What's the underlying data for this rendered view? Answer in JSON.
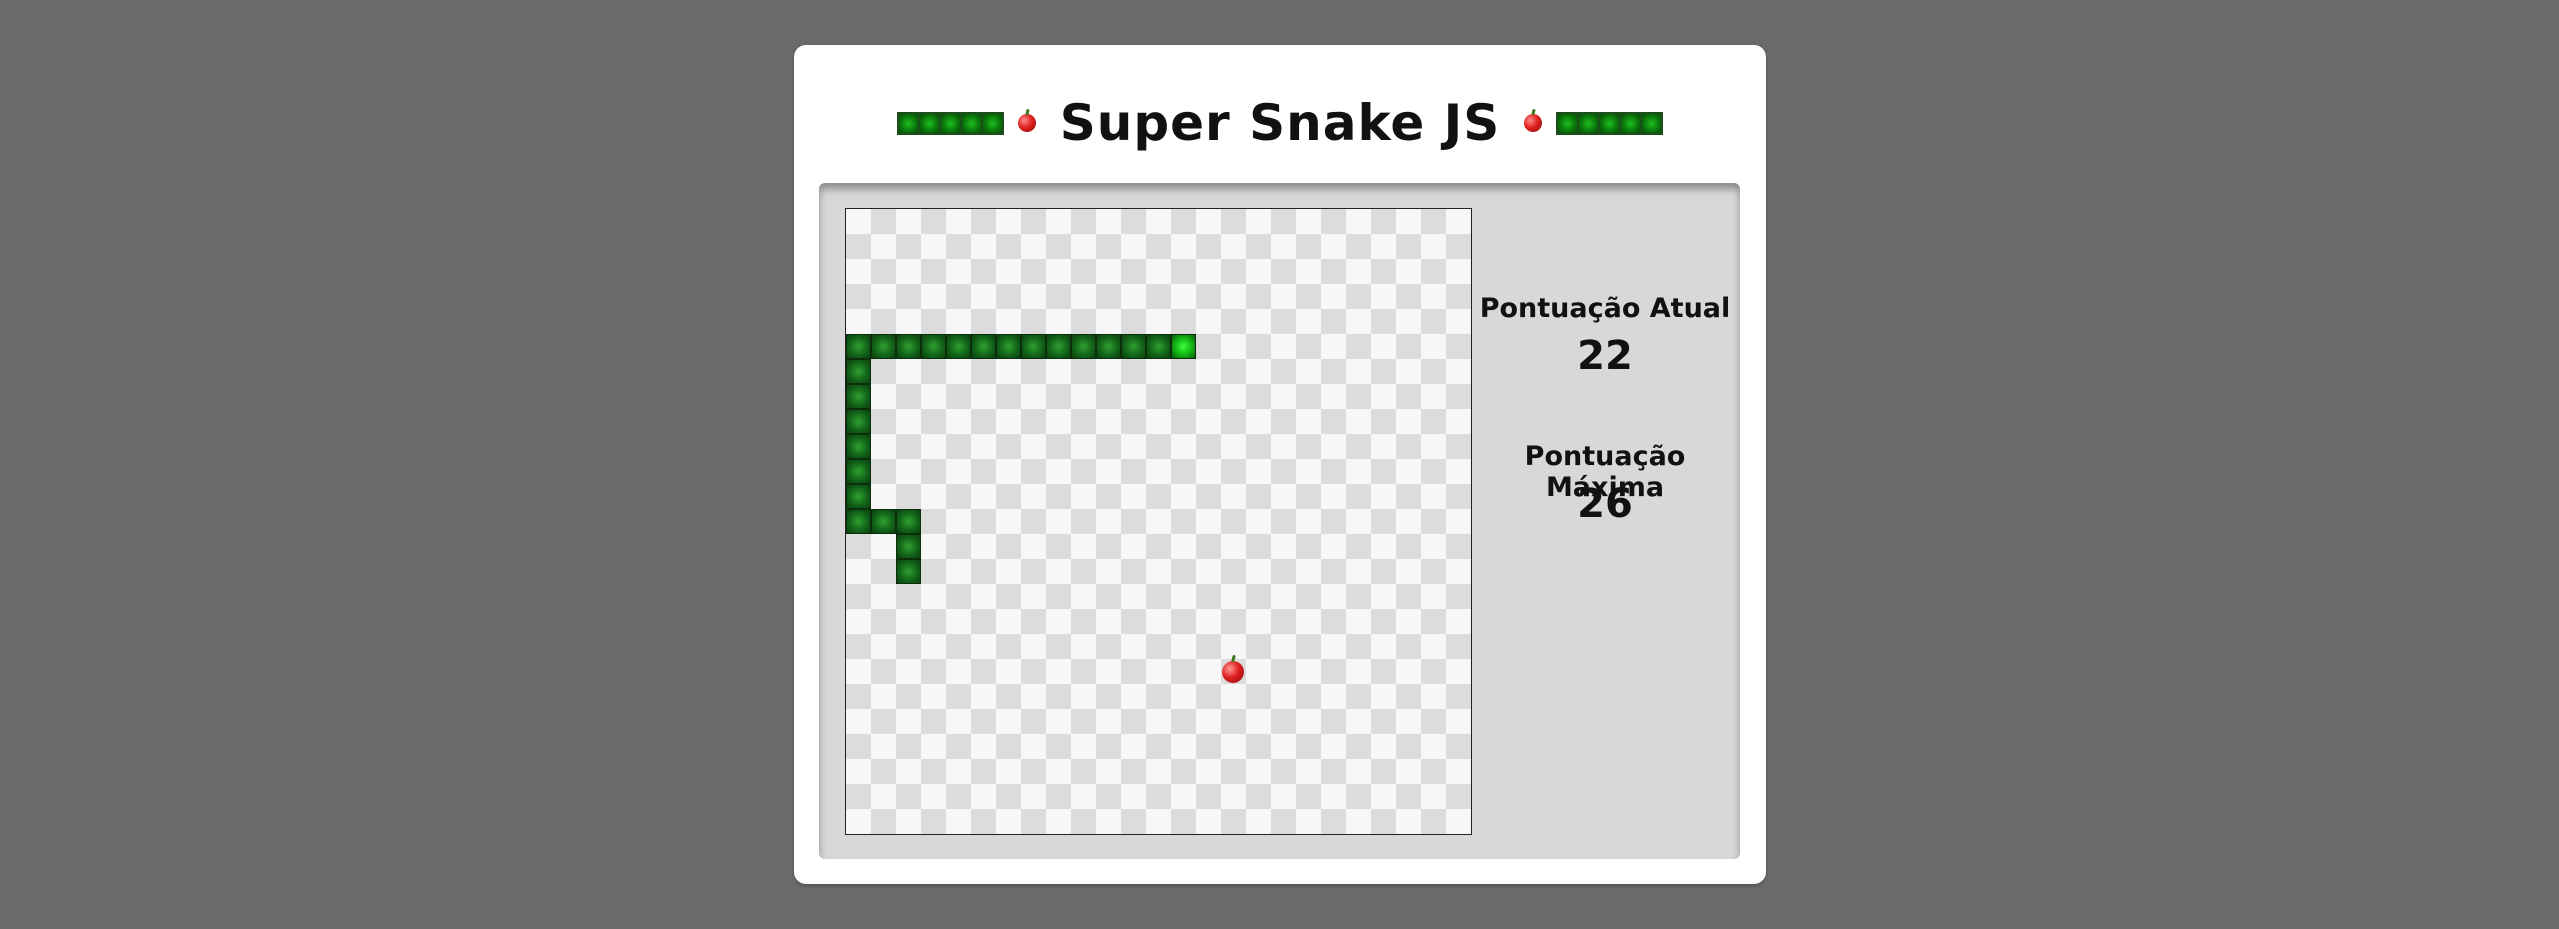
{
  "header": {
    "title": "Super Snake JS",
    "decoration_segments": 5
  },
  "scores": {
    "current_label": "Pontuação Atual",
    "current_value": "22",
    "max_label": "Pontuação Máxima",
    "max_value": "26"
  },
  "game": {
    "grid_size": 25,
    "snake": [
      [
        13,
        5
      ],
      [
        12,
        5
      ],
      [
        11,
        5
      ],
      [
        10,
        5
      ],
      [
        9,
        5
      ],
      [
        8,
        5
      ],
      [
        7,
        5
      ],
      [
        6,
        5
      ],
      [
        5,
        5
      ],
      [
        4,
        5
      ],
      [
        3,
        5
      ],
      [
        2,
        5
      ],
      [
        1,
        5
      ],
      [
        0,
        5
      ],
      [
        0,
        6
      ],
      [
        0,
        7
      ],
      [
        0,
        8
      ],
      [
        0,
        9
      ],
      [
        0,
        10
      ],
      [
        0,
        11
      ],
      [
        0,
        12
      ],
      [
        1,
        12
      ],
      [
        2,
        12
      ],
      [
        2,
        13
      ],
      [
        2,
        14
      ]
    ],
    "food": [
      15,
      18
    ]
  },
  "colors": {
    "background": "#6b6b6b",
    "snake_body": "#13651a",
    "snake_head": "#12b012",
    "food": "#e01f1f"
  }
}
